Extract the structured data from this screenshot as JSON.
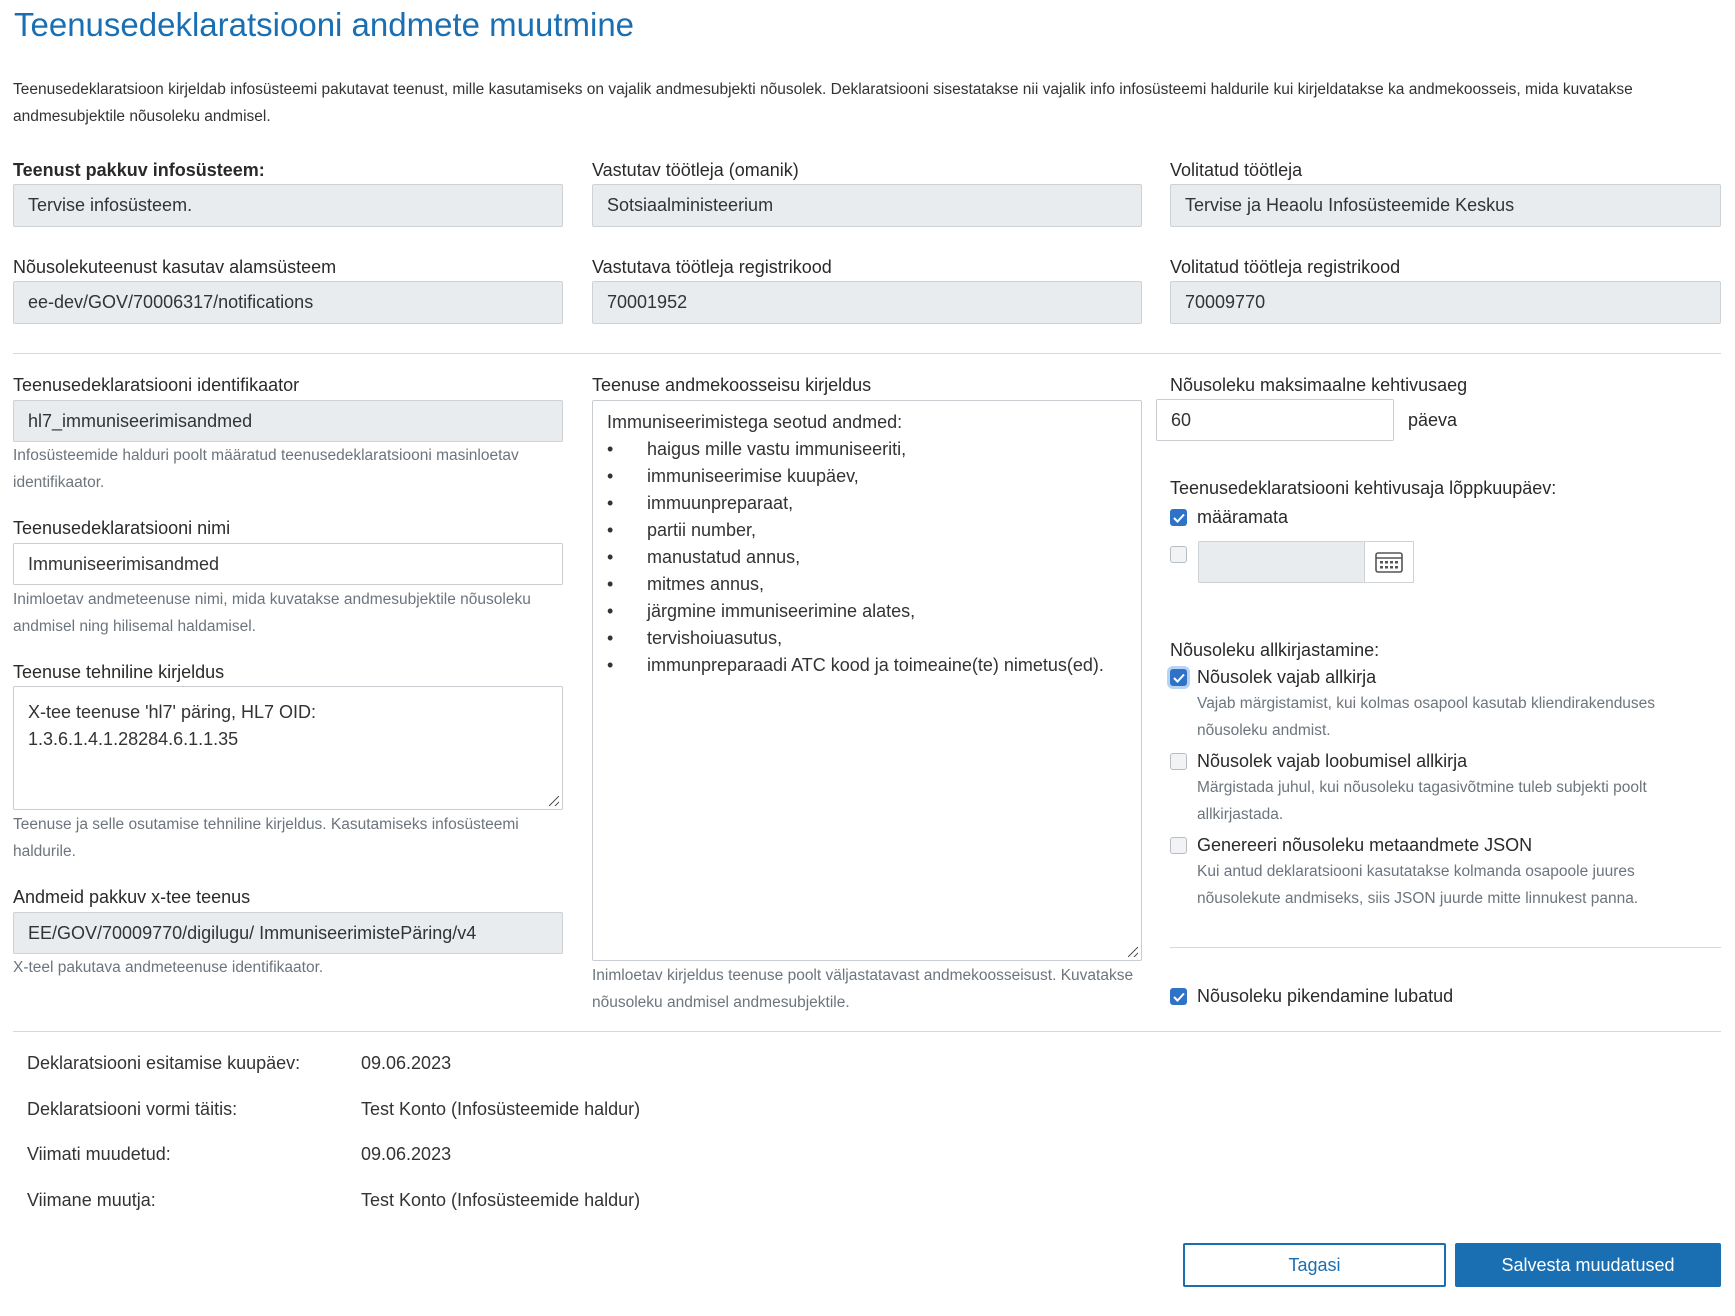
{
  "page": {
    "title": "Teenusedeklaratsiooni andmete muutmine",
    "intro": "Teenusedeklaratsioon kirjeldab infosüsteemi pakutavat teenust, mille kasutamiseks on vajalik andmesubjekti nõusolek. Deklaratsiooni sisestatakse nii vajalik info infosüsteemi haldurile kui kirjeldatakse ka andmekoosseis, mida kuvatakse andmesubjektile nõusoleku andmisel."
  },
  "top": {
    "provider_system_label": "Teenust pakkuv infosüsteem:",
    "provider_system_value": "Tervise infosüsteem.",
    "controller_label": "Vastutav töötleja (omanik)",
    "controller_value": "Sotsiaalministeerium",
    "processor_label": "Volitatud töötleja",
    "processor_value": "Tervise ja Heaolu Infosüsteemide Keskus",
    "subsystem_label": "Nõusolekuteenust kasutav alamsüsteem",
    "subsystem_value": "ee-dev/GOV/70006317/notifications",
    "controller_code_label": "Vastutava töötleja registrikood",
    "controller_code_value": "70001952",
    "processor_code_label": "Volitatud töötleja registrikood",
    "processor_code_value": "70009770"
  },
  "left": {
    "identifier_label": "Teenusedeklaratsiooni identifikaator",
    "identifier_value": "hl7_immuniseerimisandmed",
    "identifier_help": "Infosüsteemide halduri poolt määratud teenusedeklaratsiooni masinloetav identifikaator.",
    "name_label": "Teenusedeklaratsiooni nimi",
    "name_value": "Immuniseerimisandmed",
    "name_help": "Inimloetav andmeteenuse nimi, mida kuvatakse andmesubjektile nõusoleku andmisel ning hilisemal haldamisel.",
    "tech_label": "Teenuse tehniline kirjeldus",
    "tech_value_line1": "X-tee teenuse 'hl7' päring, HL7 OID:",
    "tech_value_line2": "1.3.6.1.4.1.28284.6.1.1.35",
    "tech_help": "Teenuse ja selle osutamise tehniline kirjeldus. Kasutamiseks infosüsteemi haldurile.",
    "xroad_label": "Andmeid pakkuv x-tee teenus",
    "xroad_value": "EE/GOV/70009770/digilugu/ ImmuniseerimistePäring/v4",
    "xroad_help": "X-teel pakutava andmeteenuse identifikaator."
  },
  "middle": {
    "description_label": "Teenuse andmekoosseisu kirjeldus",
    "description_heading": "Immuniseerimistega seotud andmed:",
    "bullet_char": "•",
    "description_items": [
      "haigus mille vastu immuniseeriti,",
      "immuniseerimise kuupäev,",
      "immuunpreparaat,",
      "partii number,",
      "manustatud annus,",
      "mitmes annus,",
      "järgmine immuniseerimine alates,",
      "tervishoiuasutus,",
      "immunpreparaadi ATC kood ja toimeaine(te)  nimetus(ed)."
    ],
    "description_help": "Inimloetav kirjeldus teenuse poolt väljastatavast andmekoosseisust. Kuvatakse nõusoleku andmisel andmesubjektile."
  },
  "right": {
    "max_validity_label": "Nõusoleku maksimaalne kehtivusaeg",
    "max_validity_value": "60",
    "max_validity_unit": "päeva",
    "end_date_label": "Teenusedeklaratsiooni kehtivusaja lõppkuupäev:",
    "unlimited_label": "määramata",
    "unlimited_checked": true,
    "end_date_checked": false,
    "end_date_value": "",
    "signing_label": "Nõusoleku allkirjastamine:",
    "needs_signature_label": "Nõusolek vajab allkirja",
    "needs_signature_checked": true,
    "needs_signature_help": "Vajab märgistamist, kui kolmas osapool kasutab kliendirakenduses nõusoleku andmist.",
    "revoke_signature_label": "Nõusolek vajab loobumisel allkirja",
    "revoke_signature_checked": false,
    "revoke_signature_help": "Märgistada juhul, kui nõusoleku tagasivõtmine tuleb subjekti poolt allkirjastada.",
    "json_label": "Genereeri nõusoleku metaandmete JSON",
    "json_checked": false,
    "json_help": "Kui antud deklaratsiooni kasutatakse kolmanda osapoole juures nõusolekute andmiseks, siis JSON juurde mitte linnukest panna.",
    "extension_label": "Nõusoleku pikendamine lubatud",
    "extension_checked": true
  },
  "meta": {
    "submitted_label": "Deklaratsiooni esitamise kuupäev:",
    "submitted_value": "09.06.2023",
    "filler_label": "Deklaratsiooni vormi täitis:",
    "filler_value": "Test Konto (Infosüsteemide haldur)",
    "modified_label": "Viimati muudetud:",
    "modified_value": "09.06.2023",
    "modifier_label": "Viimane muutja:",
    "modifier_value": "Test Konto (Infosüsteemide haldur)"
  },
  "actions": {
    "back_label": "Tagasi",
    "save_label": "Salvesta muudatused"
  },
  "colors": {
    "accent": "#1a6fb3",
    "checkbox": "#2e73c8",
    "readonly_bg": "#e9ecef",
    "help_text": "#6c757d"
  },
  "icons": {
    "calendar": "calendar-icon",
    "check": "checkmark-icon",
    "resize": "resize-handle-icon"
  }
}
